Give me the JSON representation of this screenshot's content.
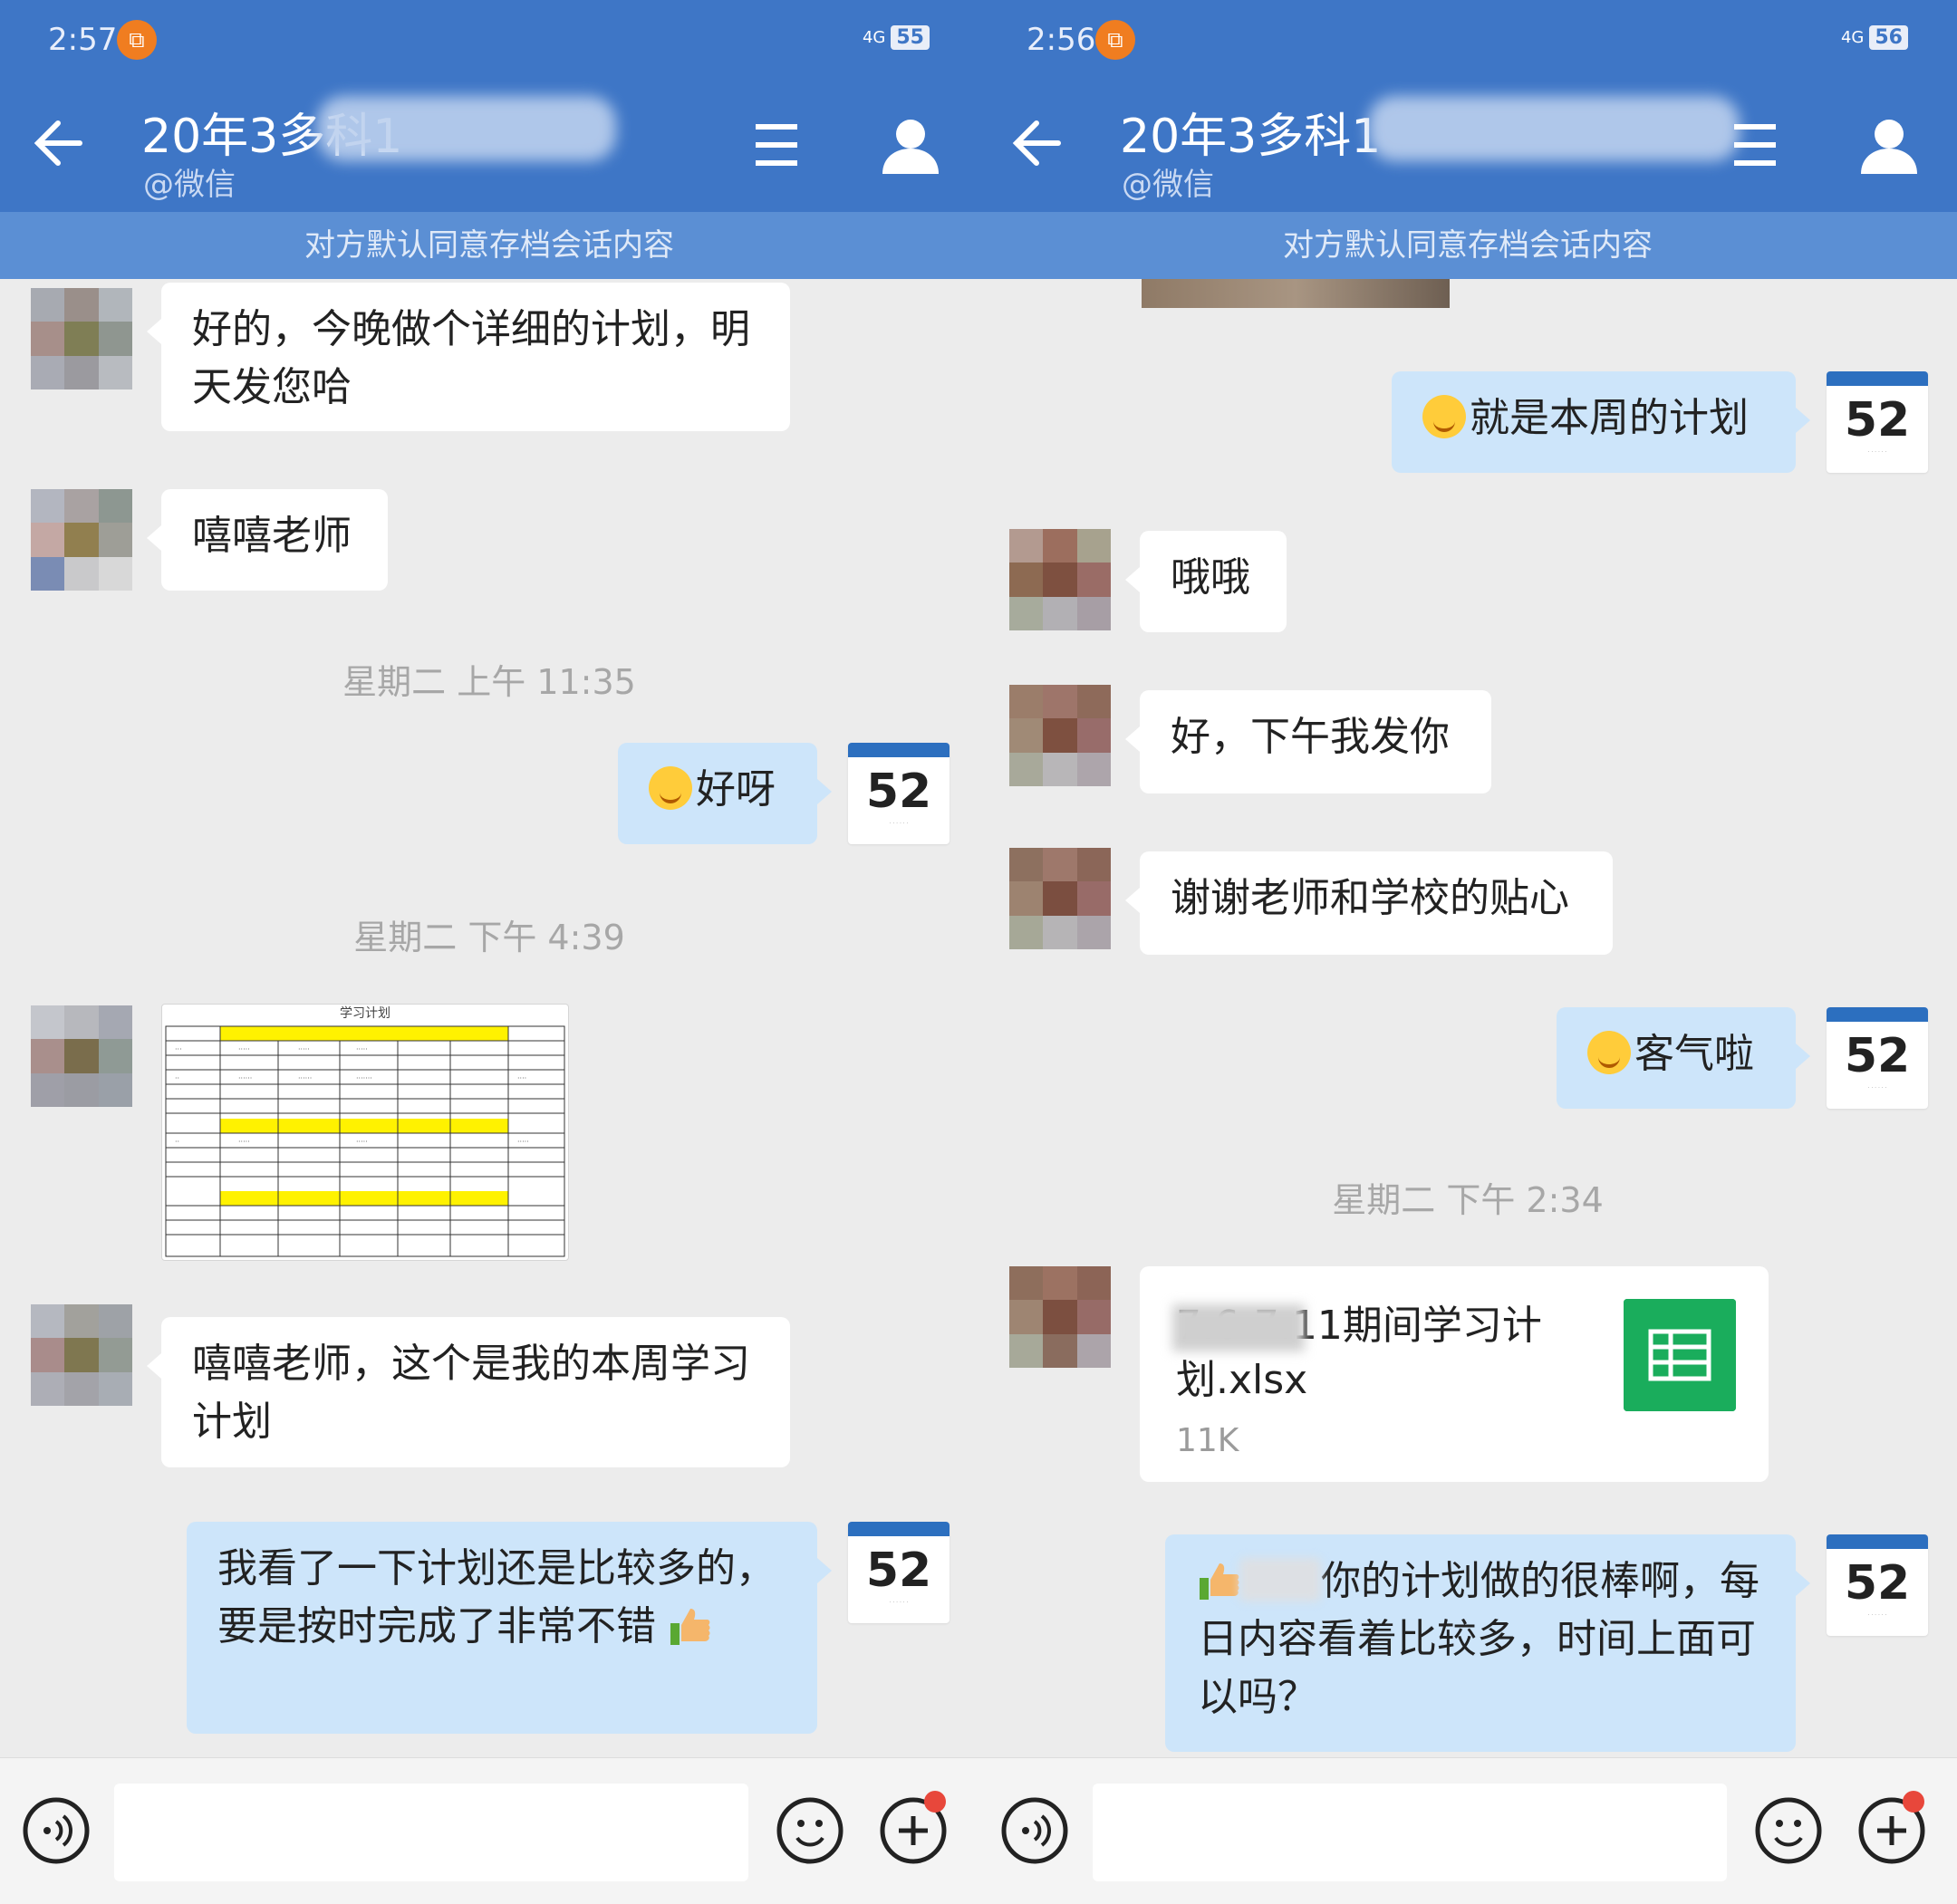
{
  "left": {
    "status": {
      "time": "2:57",
      "network": "4G",
      "battery": "55"
    },
    "header": {
      "title": "20年3多科1",
      "subtitle": "@微信"
    },
    "notice": "对方默认同意存档会话内容",
    "messages": {
      "m1": "好的，今晚做个详细的计划，明天发您哈",
      "m2": "嘻嘻老师",
      "ts1": "星期二  上午 11:35",
      "m3": "好呀",
      "ts2": "星期二  下午 4:39",
      "sheet_title": "学习计划",
      "m4": "嘻嘻老师，这个是我的本周学习计划",
      "m5": "我看了一下计划还是比较多的，要是按时完成了非常不错"
    },
    "calendar_number": "52"
  },
  "right": {
    "status": {
      "time": "2:56",
      "network": "4G",
      "battery": "56"
    },
    "header": {
      "title": "20年3多科1",
      "subtitle": "@微信"
    },
    "notice": "对方默认同意存档会话内容",
    "messages": {
      "m1": "就是本周的计划",
      "m2": "哦哦",
      "m3": "好，下午我发你",
      "m4": "谢谢老师和学校的贴心",
      "m5": "客气啦",
      "ts1": "星期二  下午 2:34",
      "file_name": "7.6-7.11期间学习计划.xlsx",
      "file_size": "11K",
      "m6": "你的计划做的很棒啊，每日内容看着比较多，时间上面可以吗？"
    },
    "calendar_number": "52"
  },
  "colors": {
    "header": "#3e76c6",
    "notice": "#5b8fd4",
    "outgoing_bubble": "#cde5fa",
    "incoming_bubble": "#ffffff",
    "file_icon": "#1aad5c"
  },
  "icons": [
    "back-arrow-icon",
    "menu-icon",
    "user-icon",
    "voice-icon",
    "emoji-icon",
    "plus-icon",
    "spreadsheet-icon",
    "thumbs-up-icon",
    "smile-emoji-icon",
    "grin-emoji-icon"
  ]
}
